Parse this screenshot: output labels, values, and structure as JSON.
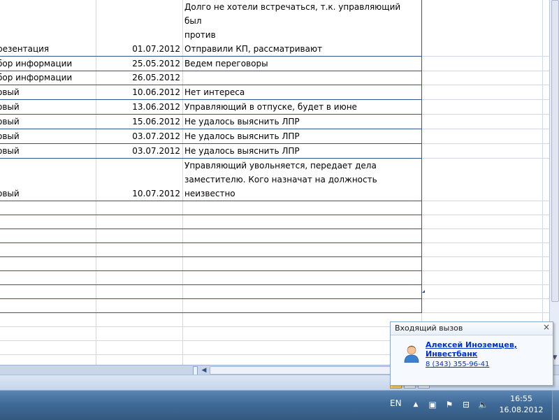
{
  "sheet": {
    "rows": [
      {
        "stage": "",
        "date": "",
        "comment": "Долго не хотели встречаться, т.к. управляющий был"
      },
      {
        "stage": "",
        "date": "",
        "comment": "против"
      },
      {
        "stage": "резентация",
        "date": "01.07.2012",
        "comment": "Отправили КП, рассматривают"
      },
      {
        "stage": "бор информации",
        "date": "25.05.2012",
        "comment": "Ведем переговоры"
      },
      {
        "stage": "бор информации",
        "date": "26.05.2012",
        "comment": ""
      },
      {
        "stage": "овый",
        "date": "10.06.2012",
        "comment": "Нет интереса"
      },
      {
        "stage": "овый",
        "date": "13.06.2012",
        "comment": "Управляющий в отпуске, будет в июне"
      },
      {
        "stage": "овый",
        "date": "15.06.2012",
        "comment": "Не удалось выяснить ЛПР"
      },
      {
        "stage": "овый",
        "date": "03.07.2012",
        "comment": "Не удалось выяснить ЛПР"
      },
      {
        "stage": "овый",
        "date": "03.07.2012",
        "comment": "Не удалось выяснить ЛПР"
      },
      {
        "stage": "",
        "date": "",
        "comment": "Управляющий увольняется, передает дела"
      },
      {
        "stage": "",
        "date": "",
        "comment": "заместителю. Кого назначат на должность"
      },
      {
        "stage": "овый",
        "date": "10.07.2012",
        "comment": "неизвестно"
      }
    ]
  },
  "taskbar": {
    "language": "EN",
    "time": "16:55",
    "date": "16.08.2012"
  },
  "call_popup": {
    "title": "Входящий вызов",
    "close_label": "×",
    "caller_name_line1": "Алексей Иноземцев,",
    "caller_name_line2": "Инвестбанк",
    "phone": "8 (343) 355-96-41"
  },
  "icons": {
    "scroll_down": "▼",
    "scroll_left": "◀",
    "tray_up": "▲",
    "tray_network": "▣",
    "tray_flag": "⚑",
    "tray_computer": "⊟",
    "tray_volume": "🔈"
  }
}
